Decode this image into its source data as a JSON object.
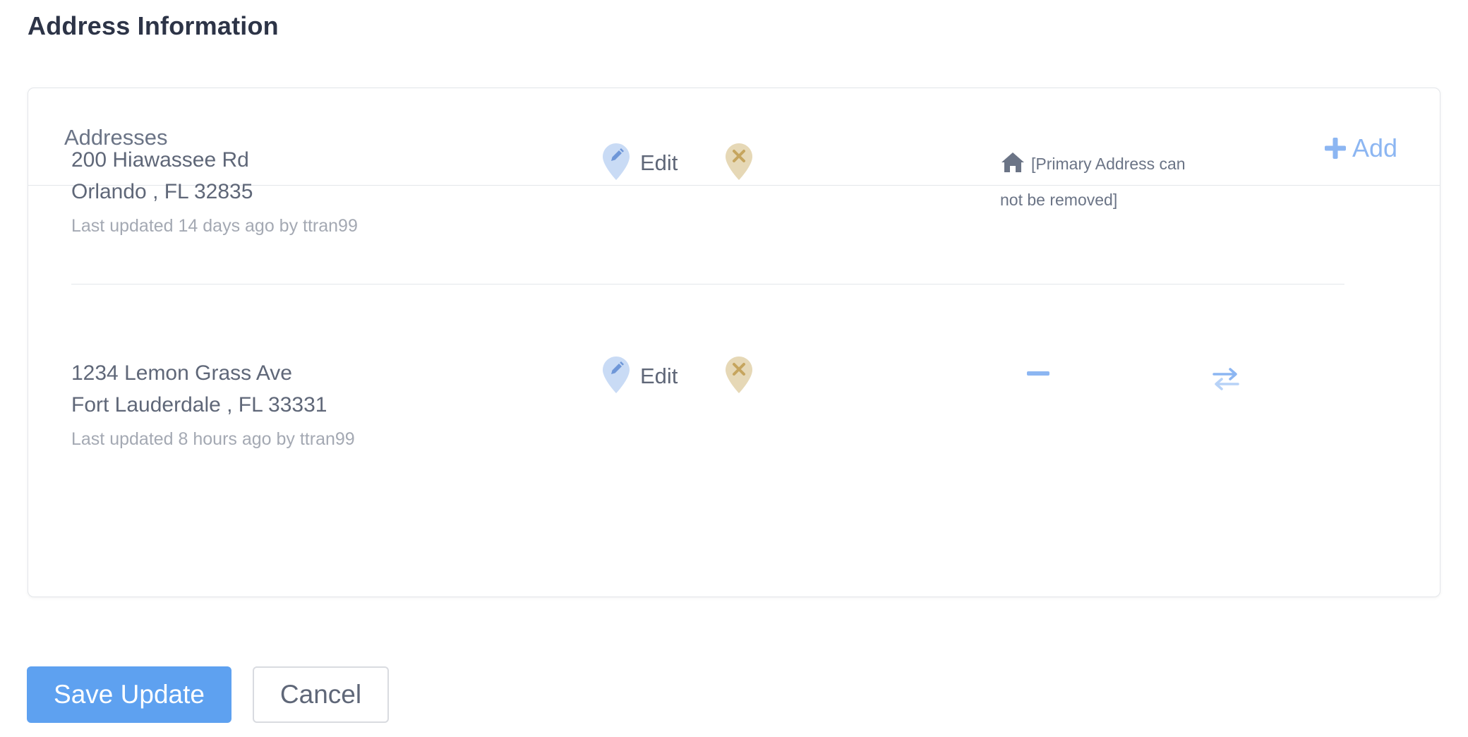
{
  "page": {
    "title": "Address Information"
  },
  "addresses_card": {
    "title": "Addresses",
    "add_label": "Add",
    "add_icon": "plus-icon"
  },
  "addresses": [
    {
      "line1": "200 Hiawassee Rd",
      "line2": "Orlando , FL 32835",
      "meta": "Last updated 14 days ago by ttran99",
      "edit_label": "Edit",
      "edit_icon": "map-pin-pencil-icon",
      "remove_icon": "map-pin-x-icon",
      "is_primary": true,
      "primary_icon": "home-icon",
      "primary_note": "[Primary Address can not be removed]"
    },
    {
      "line1": "1234 Lemon Grass Ave",
      "line2": "Fort Lauderdale , FL 33331",
      "meta": "Last updated 8 hours ago by ttran99",
      "edit_label": "Edit",
      "edit_icon": "map-pin-pencil-icon",
      "remove_icon": "map-pin-x-icon",
      "is_primary": false,
      "demote_icon": "minus-icon",
      "swap_icon": "swap-arrows-icon"
    }
  ],
  "actions": {
    "save_label": "Save Update",
    "cancel_label": "Cancel"
  },
  "colors": {
    "primary_button": "#5ea1f0",
    "link_blue": "#8cb6f2",
    "edit_pin": "#c9dbf5",
    "remove_pin": "#e6d8b6",
    "remove_x": "#c6a55e",
    "title_text": "#2d3447",
    "body_text": "#5f6778",
    "muted_text": "#a4a9b3"
  }
}
